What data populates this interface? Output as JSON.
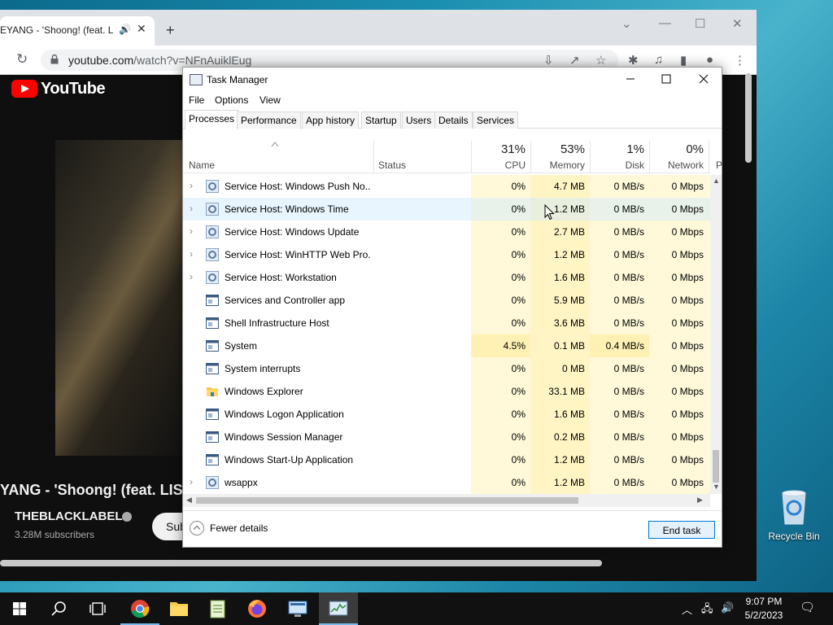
{
  "desktop": {
    "recycle_bin_label": "Recycle Bin"
  },
  "chrome": {
    "tab_title": "EYANG - 'Shoong! (feat. LI",
    "url_main": "youtube.com",
    "url_path": "/watch?v=NFnAuiklEug",
    "youtube": {
      "logo_text": "YouTube",
      "video_title": "YANG - 'Shoong! (feat. LISA",
      "channel": "THEBLACKLABEL",
      "subscribers": "3.28M subscribers",
      "subscribe_label": "Sub"
    }
  },
  "taskmanager": {
    "title": "Task Manager",
    "menu": [
      "File",
      "Options",
      "View"
    ],
    "tabs": [
      "Processes",
      "Performance",
      "App history",
      "Startup",
      "Users",
      "Details",
      "Services"
    ],
    "header": {
      "name": "Name",
      "status": "Status",
      "cpu_pct": "31%",
      "cpu": "CPU",
      "mem_pct": "53%",
      "mem": "Memory",
      "disk_pct": "1%",
      "disk": "Disk",
      "net_pct": "0%",
      "net": "Network",
      "power": "P"
    },
    "rows": [
      {
        "name": "Service Host: Windows Push No...",
        "cpu": "0%",
        "mem": "4.7 MB",
        "disk": "0 MB/s",
        "net": "0 Mbps"
      },
      {
        "name": "Service Host: Windows Time",
        "cpu": "0%",
        "mem": "1.2 MB",
        "disk": "0 MB/s",
        "net": "0 Mbps"
      },
      {
        "name": "Service Host: Windows Update",
        "cpu": "0%",
        "mem": "2.7 MB",
        "disk": "0 MB/s",
        "net": "0 Mbps"
      },
      {
        "name": "Service Host: WinHTTP Web Pro...",
        "cpu": "0%",
        "mem": "1.2 MB",
        "disk": "0 MB/s",
        "net": "0 Mbps"
      },
      {
        "name": "Service Host: Workstation",
        "cpu": "0%",
        "mem": "1.6 MB",
        "disk": "0 MB/s",
        "net": "0 Mbps"
      },
      {
        "name": "Services and Controller app",
        "cpu": "0%",
        "mem": "5.9 MB",
        "disk": "0 MB/s",
        "net": "0 Mbps"
      },
      {
        "name": "Shell Infrastructure Host",
        "cpu": "0%",
        "mem": "3.6 MB",
        "disk": "0 MB/s",
        "net": "0 Mbps"
      },
      {
        "name": "System",
        "cpu": "4.5%",
        "mem": "0.1 MB",
        "disk": "0.4 MB/s",
        "net": "0 Mbps"
      },
      {
        "name": "System interrupts",
        "cpu": "0%",
        "mem": "0 MB",
        "disk": "0 MB/s",
        "net": "0 Mbps"
      },
      {
        "name": "Windows Explorer",
        "cpu": "0%",
        "mem": "33.1 MB",
        "disk": "0 MB/s",
        "net": "0 Mbps"
      },
      {
        "name": "Windows Logon Application",
        "cpu": "0%",
        "mem": "1.6 MB",
        "disk": "0 MB/s",
        "net": "0 Mbps"
      },
      {
        "name": "Windows Session Manager",
        "cpu": "0%",
        "mem": "0.2 MB",
        "disk": "0 MB/s",
        "net": "0 Mbps"
      },
      {
        "name": "Windows Start-Up Application",
        "cpu": "0%",
        "mem": "1.2 MB",
        "disk": "0 MB/s",
        "net": "0 Mbps"
      },
      {
        "name": "wsappx",
        "cpu": "0%",
        "mem": "1.2 MB",
        "disk": "0 MB/s",
        "net": "0 Mbps"
      }
    ],
    "fewer_details": "Fewer details",
    "end_task": "End task"
  },
  "taskbar": {
    "time": "9:07 PM",
    "date": "5/2/2023"
  }
}
